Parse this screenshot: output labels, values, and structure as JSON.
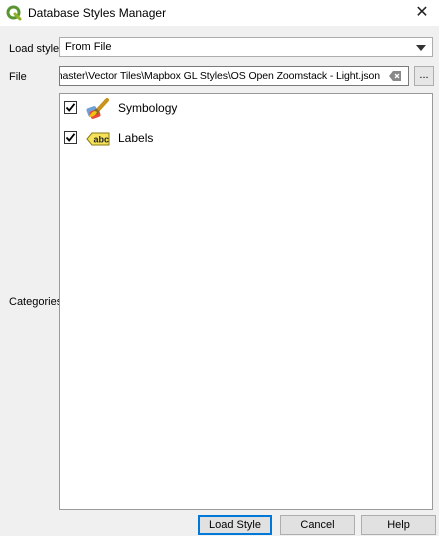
{
  "window": {
    "title": "Database Styles Manager",
    "icon": "qgis-logo-icon"
  },
  "form": {
    "load_style_label": "Load style",
    "load_style_value": "From File",
    "file_label": "File",
    "file_path": "eets-master\\Vector Tiles\\Mapbox GL Styles\\OS Open Zoomstack - Light.json",
    "browse_label": "...",
    "categories_label": "Categories"
  },
  "categories": [
    {
      "label": "Symbology",
      "checked": true,
      "icon": "paint-brush-icon"
    },
    {
      "label": "Labels",
      "checked": true,
      "icon": "abc-label-icon"
    }
  ],
  "buttons": {
    "load_style": "Load Style",
    "cancel": "Cancel",
    "help": "Help"
  }
}
